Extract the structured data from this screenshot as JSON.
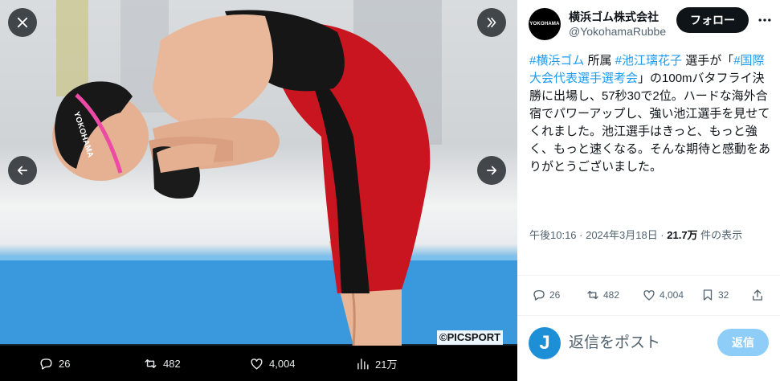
{
  "media": {
    "credit": "©PICSPORT",
    "cap_text": "YOKOHAMA",
    "actions": {
      "replies": "26",
      "retweets": "482",
      "likes": "4,004",
      "views": "21万"
    }
  },
  "tweet": {
    "user": {
      "name": "横浜ゴム株式会社",
      "handle": "@YokohamaRubbe",
      "avatar_text": "YOKOHAMA"
    },
    "follow_label": "フォロー",
    "body": {
      "tag1": "#横浜ゴム",
      "t1": " 所属 ",
      "tag2": "#池江璃花子",
      "t2": " 選手が「",
      "tag3": "#国際大会代表選手選考会",
      "t3": "」の100mバタフライ決勝に出場し、57秒30で2位。ハードな海外合宿でパワーアップし、強い池江選手を見せてくれました。池江選手はきっと、もっと強く、もっと速くなる。そんな期待と感動をありがとうございました。"
    },
    "meta": {
      "timestamp": "午後10:16 · 2024年3月18日 · ",
      "views_count": "21.7万",
      "views_label": " 件の表示"
    },
    "actions": {
      "replies": "26",
      "retweets": "482",
      "likes": "4,004",
      "bookmarks": "32"
    },
    "reply": {
      "avatar_text": "J",
      "placeholder": "返信をポスト",
      "button_label": "返信"
    }
  },
  "colors": {
    "accent": "#1d9bf0",
    "text": "#0f1419",
    "muted": "#536471",
    "reply_disabled": "#8ecdf7"
  }
}
